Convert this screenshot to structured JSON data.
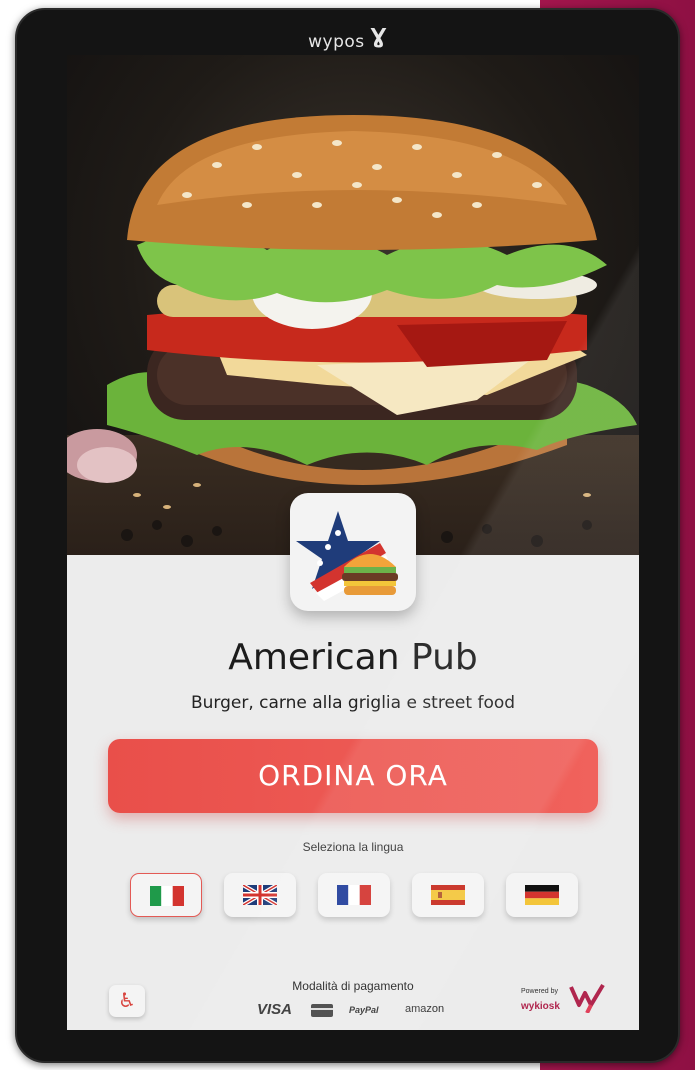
{
  "device": {
    "brand": "wypos",
    "brand_mark": "Ɣ"
  },
  "venue": {
    "name": "American Pub",
    "tagline": "Burger, carne alla griglia e street food"
  },
  "order_button": {
    "label": "ORDINA ORA"
  },
  "language": {
    "label": "Seleziona la lingua",
    "options": [
      {
        "code": "it",
        "active": true
      },
      {
        "code": "en",
        "active": false
      },
      {
        "code": "fr",
        "active": false
      },
      {
        "code": "es",
        "active": false
      },
      {
        "code": "de",
        "active": false
      }
    ]
  },
  "accessibility": {
    "icon": "wheelchair-icon",
    "glyph": "♿"
  },
  "payment": {
    "label": "Modalità di pagamento",
    "methods": {
      "visa": "VISA",
      "paypal": "PayPal",
      "amazon": "amazon"
    }
  },
  "powered_by": {
    "label": "Powered by",
    "name": "wykiosk"
  },
  "colors": {
    "accent": "#ee5a55",
    "brand_magenta": "#a3164d",
    "screen_bg": "#ececec"
  }
}
